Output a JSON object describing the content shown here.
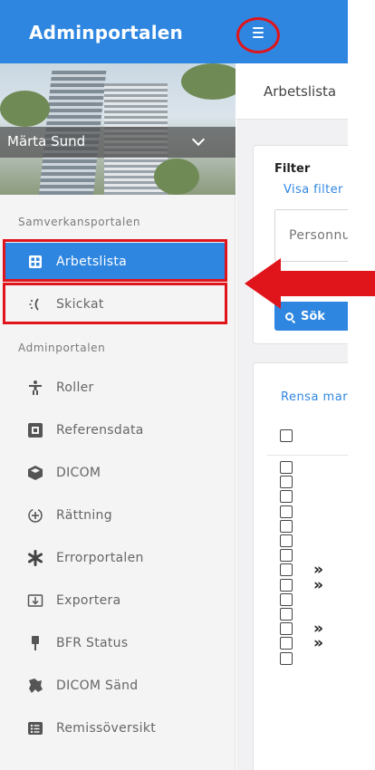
{
  "header": {
    "title": "Adminportalen",
    "menu_icon": "hamburger-menu-icon",
    "accent_color": "#2f86e0"
  },
  "profile": {
    "name": "Märta Sund",
    "chevron_icon": "chevron-down-icon"
  },
  "sidebar": {
    "sections": [
      {
        "label": "Samverkansportalen",
        "items": [
          {
            "label": "Arbetslista",
            "icon": "grid-icon",
            "active": true
          },
          {
            "label": "Skickat",
            "icon": "spinner-icon",
            "active": false
          }
        ]
      },
      {
        "label": "Adminportalen",
        "items": [
          {
            "label": "Roller",
            "icon": "person-icon"
          },
          {
            "label": "Referensdata",
            "icon": "database-box-icon"
          },
          {
            "label": "DICOM",
            "icon": "cube-icon"
          },
          {
            "label": "Rättning",
            "icon": "rotate-plus-icon"
          },
          {
            "label": "Errorportalen",
            "icon": "asterisk-icon"
          },
          {
            "label": "Exportera",
            "icon": "export-icon"
          },
          {
            "label": "BFR Status",
            "icon": "pin-icon"
          },
          {
            "label": "DICOM Sänd",
            "icon": "send-icon"
          },
          {
            "label": "Remissöversikt",
            "icon": "list-icon"
          }
        ]
      }
    ]
  },
  "main": {
    "breadcrumb": "Arbetslista",
    "filter": {
      "title": "Filter",
      "toggle_link": "Visa filter",
      "input_placeholder": "Personnummer",
      "search_label": "Sök"
    },
    "list": {
      "clear_link": "Rensa markering",
      "rows": [
        {
          "arrow": ""
        },
        {
          "arrow": ""
        },
        {
          "arrow": ""
        },
        {
          "arrow": ""
        },
        {
          "arrow": ""
        },
        {
          "arrow": ""
        },
        {
          "arrow": ""
        },
        {
          "arrow": "»"
        },
        {
          "arrow": "»"
        },
        {
          "arrow": ""
        },
        {
          "arrow": ""
        },
        {
          "arrow": "»"
        },
        {
          "arrow": "»"
        },
        {
          "arrow": ""
        }
      ]
    }
  },
  "annotations": {
    "highlight_color": "#e0141b"
  }
}
